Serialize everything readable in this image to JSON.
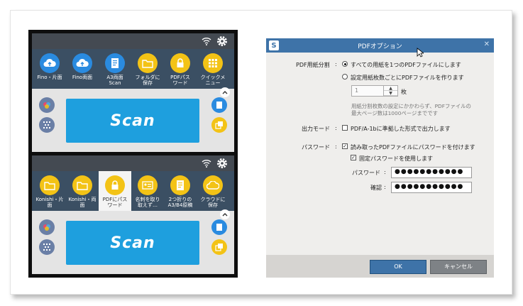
{
  "colors": {
    "statusbar": "#444a52",
    "iconrow": "#3b4f63",
    "scan_blue": "#1e9fde",
    "shortcut_yellow": "#f3c316",
    "dialog_title": "#3e73a8"
  },
  "panel_top": {
    "buttons": [
      {
        "label": "Fino・片面",
        "icon": "cloud-upload-icon",
        "color": "blue"
      },
      {
        "label": "Fino両面",
        "icon": "cloud-upload-icon",
        "color": "blue"
      },
      {
        "label": "A3両面\nScan",
        "icon": "document-icon",
        "color": "blue"
      },
      {
        "label": "フォルダに\n保存",
        "icon": "folder-icon",
        "color": "yellow"
      },
      {
        "label": "PDFパス\nワード",
        "icon": "lock-icon",
        "color": "yellow"
      },
      {
        "label": "クイックメ\nニュー",
        "icon": "grid-icon",
        "color": "yellow"
      }
    ],
    "scan_label": "Scan"
  },
  "panel_bottom": {
    "buttons": [
      {
        "label": "Konishi・片\n面",
        "icon": "folder-icon",
        "color": "yellow"
      },
      {
        "label": "Konishi・両\n面",
        "icon": "folder-icon",
        "color": "yellow"
      },
      {
        "label": "PDFにパス\nワード",
        "icon": "lock-icon",
        "color": "yellow",
        "selected": true
      },
      {
        "label": "名刺を取り\n取えず…",
        "icon": "card-icon",
        "color": "yellow"
      },
      {
        "label": "2つ折りの\nA3/B4原稿",
        "icon": "document-icon",
        "color": "yellow"
      },
      {
        "label": "クラウドに\n保存",
        "icon": "cloud-icon",
        "color": "yellow"
      }
    ],
    "scan_label": "Scan"
  },
  "dialog": {
    "title": "PDFオプション",
    "split_label": "PDF用紙分割",
    "colon": ":",
    "option_all": "すべての用紙を1つのPDFファイルにします",
    "option_per": "設定用紙枚数ごとにPDFファイルを作ります",
    "spin_value": "1",
    "spin_unit": "枚",
    "note": "用紙分割枚数の設定にかかわらず、PDFファイルの\n最大ページ数は1000ページまでです",
    "output_label": "出力モード",
    "output_option": "PDF/A-1bに準拠した形式で出力します",
    "password_label": "パスワード",
    "password_option": "読み取ったPDFファイルにパスワードを付けます",
    "fixed_option": "固定パスワードを使用します",
    "pw_label": "パスワード",
    "confirm_label": "確認",
    "pw_value": "●●●●●●●●●●●",
    "confirm_value": "●●●●●●●●●●●",
    "ok_label": "OK",
    "cancel_label": "キャンセル"
  }
}
